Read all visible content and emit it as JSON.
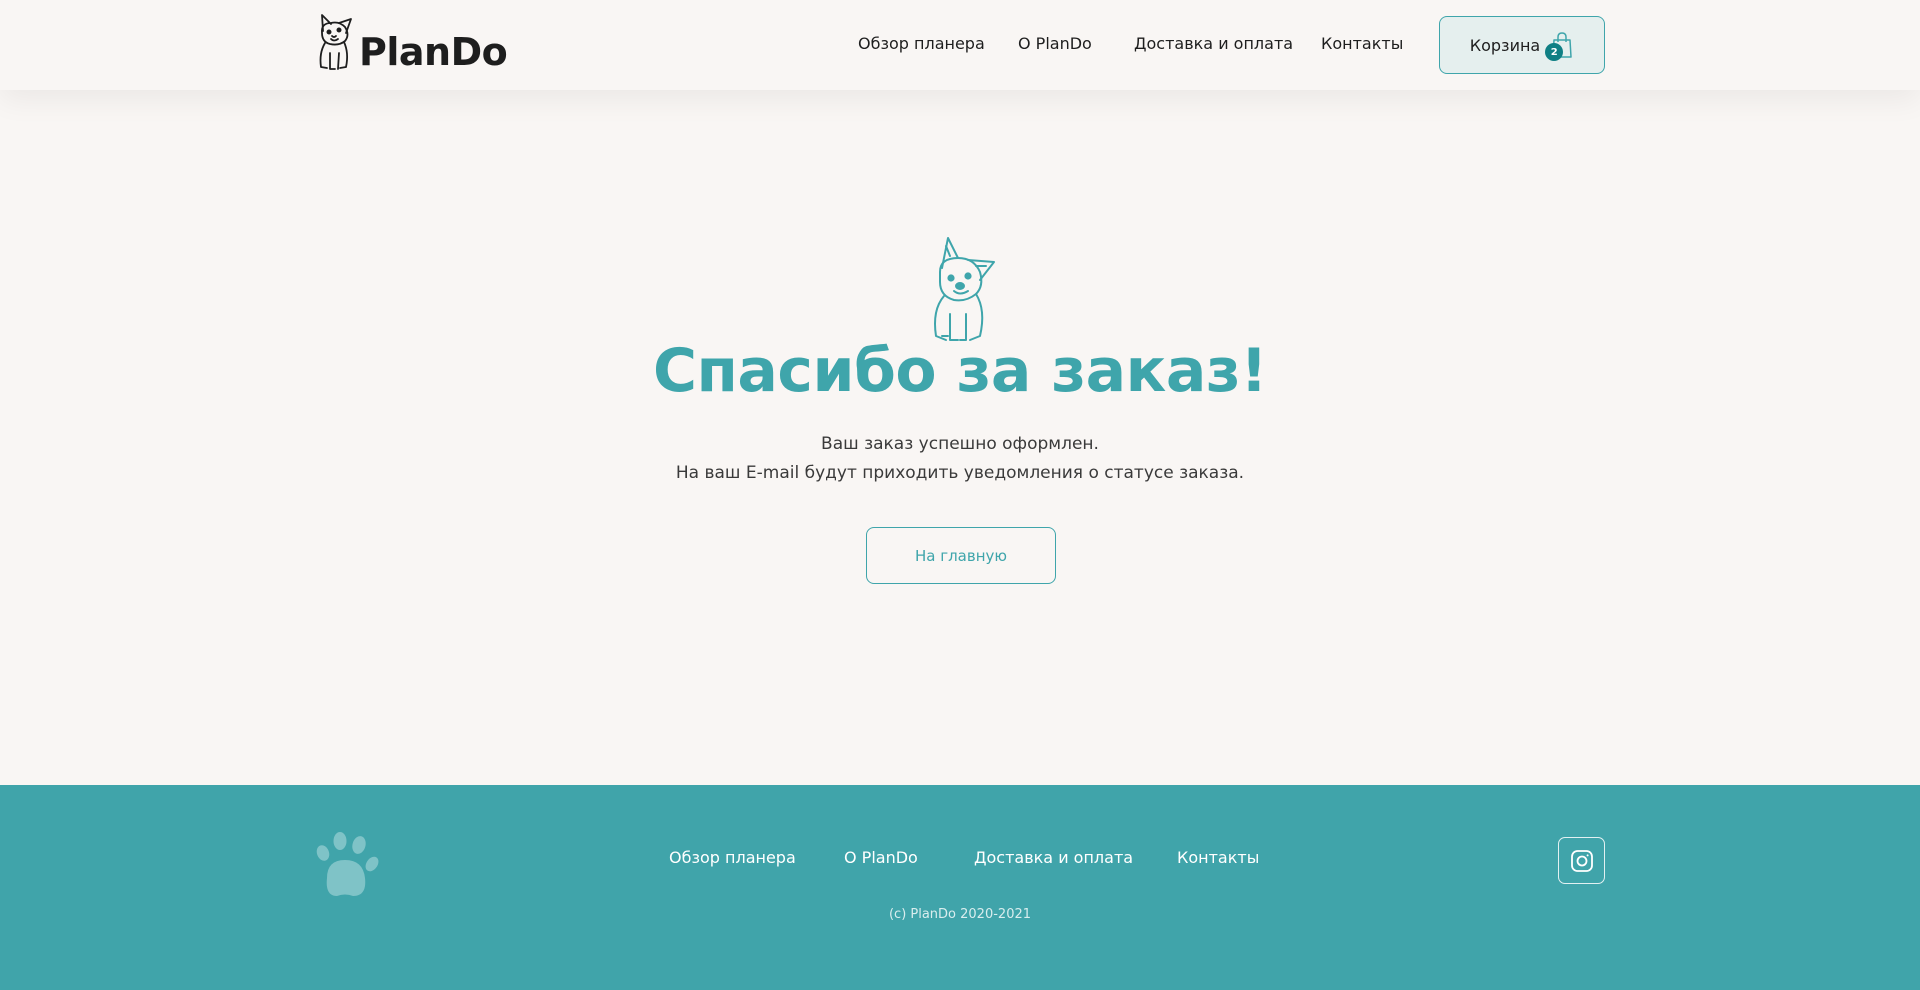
{
  "header": {
    "logo_text": "PlanDo",
    "nav": [
      {
        "label": "Обзор планера"
      },
      {
        "label": "О PlanDo"
      },
      {
        "label": "Доставка и оплата"
      },
      {
        "label": "Контакты"
      }
    ],
    "cart": {
      "label": "Корзина",
      "count": "2"
    }
  },
  "main": {
    "title": "Спасибо за заказ!",
    "line1": "Ваш заказ успешно оформлен.",
    "line2": "На ваш E-mail будут приходить уведомления о статусе заказа.",
    "home_button": "На главную"
  },
  "footer": {
    "nav": [
      {
        "label": "Обзор планера"
      },
      {
        "label": "О PlanDo"
      },
      {
        "label": "Доставка и оплата"
      },
      {
        "label": "Контакты"
      }
    ],
    "copyright": "(c) PlanDo 2020-2021"
  },
  "colors": {
    "accent": "#3fa5ab",
    "footer_bg": "#40a4aa",
    "page_bg": "#f9f6f4",
    "badge": "#0f7f84"
  },
  "icons": [
    "dog-logo-icon",
    "shopping-bag-icon",
    "paw-icon",
    "instagram-icon"
  ]
}
